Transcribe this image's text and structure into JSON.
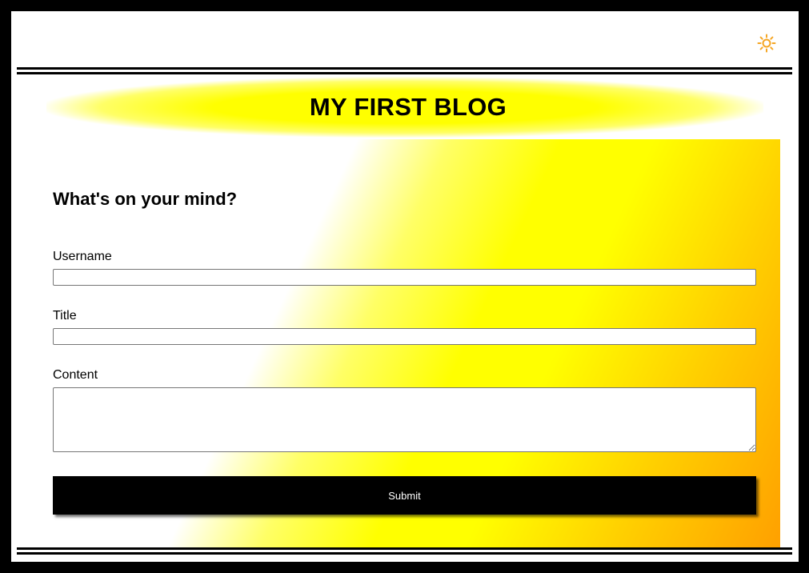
{
  "header": {
    "theme_toggle_icon": "sun-icon",
    "accent_color": "#f5a623"
  },
  "blog": {
    "title": "MY FIRST BLOG"
  },
  "form": {
    "heading": "What's on your mind?",
    "username_label": "Username",
    "username_value": "",
    "title_label": "Title",
    "title_value": "",
    "content_label": "Content",
    "content_value": "",
    "submit_label": "Submit"
  },
  "colors": {
    "background": "#000000",
    "banner_glow": "#ffff00",
    "gradient_end": "#ffa000",
    "button": "#000000"
  }
}
